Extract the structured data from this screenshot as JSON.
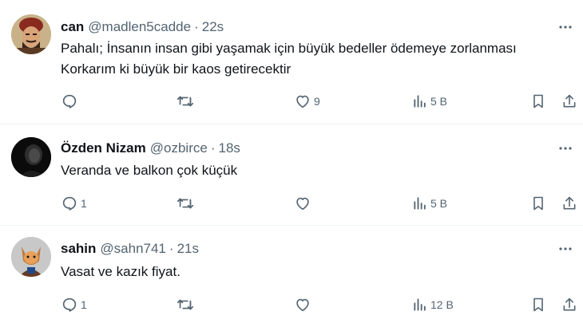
{
  "tweets": [
    {
      "name": "can",
      "handle": "@madlen5cadde",
      "separator": "·",
      "time": "22s",
      "text_lines": [
        "Pahalı; İnsanın insan gibi yaşamak için büyük bedeller ödemeye zorlanması",
        "Korkarım ki büyük bir kaos getirecektir"
      ],
      "reply_count": "",
      "like_count": "9",
      "view_count": "5 B"
    },
    {
      "name": "Özden Nizam",
      "handle": "@ozbirce",
      "separator": "·",
      "time": "18s",
      "text_lines": [
        "Veranda ve balkon çok küçük"
      ],
      "reply_count": "1",
      "like_count": "",
      "view_count": "5 B"
    },
    {
      "name": "sahin",
      "handle": "@sahn741",
      "separator": "·",
      "time": "21s",
      "text_lines": [
        "Vasat ve kazık fiyat."
      ],
      "reply_count": "1",
      "like_count": "",
      "view_count": "12 B"
    }
  ],
  "colors": {
    "text_primary": "#0f1419",
    "text_secondary": "#536471",
    "divider": "#eff3f4",
    "background": "#ffffff"
  },
  "icons": [
    "more-icon",
    "reply-icon",
    "retweet-icon",
    "like-icon",
    "views-icon",
    "bookmark-icon",
    "share-icon"
  ]
}
